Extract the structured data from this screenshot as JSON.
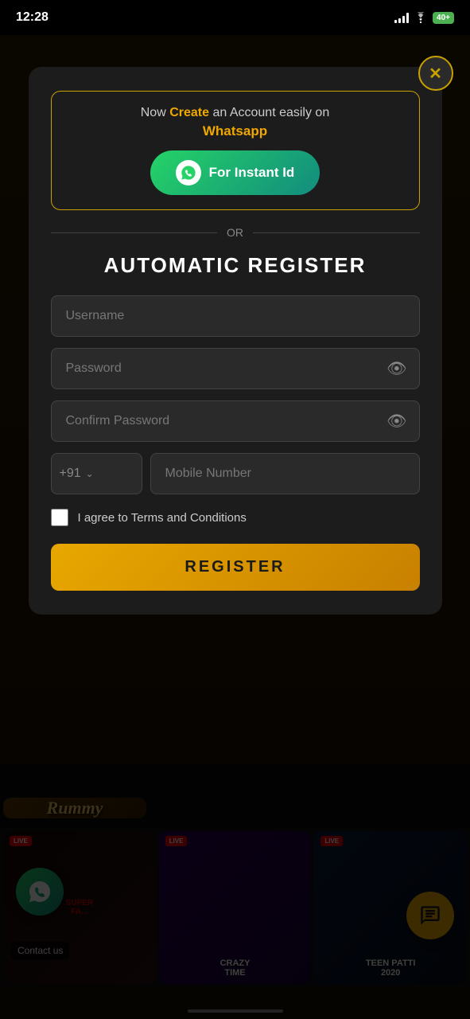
{
  "statusBar": {
    "time": "12:28",
    "battery": "40+"
  },
  "modal": {
    "closeIcon": "✕",
    "whatsapp": {
      "line1": "Now ",
      "create": "Create",
      "line2": " an Account easily on",
      "appName": "Whatsapp",
      "btnLabel": "For Instant Id"
    },
    "divider": "OR",
    "title": "AUTOMATIC REGISTER",
    "fields": {
      "username": {
        "placeholder": "Username"
      },
      "password": {
        "placeholder": "Password"
      },
      "confirmPassword": {
        "placeholder": "Confirm Password"
      },
      "countryCode": "+91",
      "mobileNumber": {
        "placeholder": "Mobile Number"
      }
    },
    "terms": "I agree to Terms and Conditions",
    "registerBtn": "REGISTER"
  },
  "gameStrip1": [
    {
      "label": "Rummy",
      "type": "rummy"
    },
    {
      "label": "",
      "type": "dark"
    },
    {
      "label": "",
      "type": "red"
    }
  ],
  "gameStrip2": [
    {
      "label": "LIVE",
      "title": "SUPER\nFA...",
      "type": "super"
    },
    {
      "label": "LIVE",
      "title": "CRAZY TIME",
      "type": "crazy"
    },
    {
      "label": "LIVE",
      "title": "TEEN PATTI 2020",
      "type": "teen"
    }
  ],
  "floatWhatsapp": "Contact us",
  "icons": {
    "eye": "👁",
    "whatsapp": "💬",
    "chat": "💬"
  }
}
